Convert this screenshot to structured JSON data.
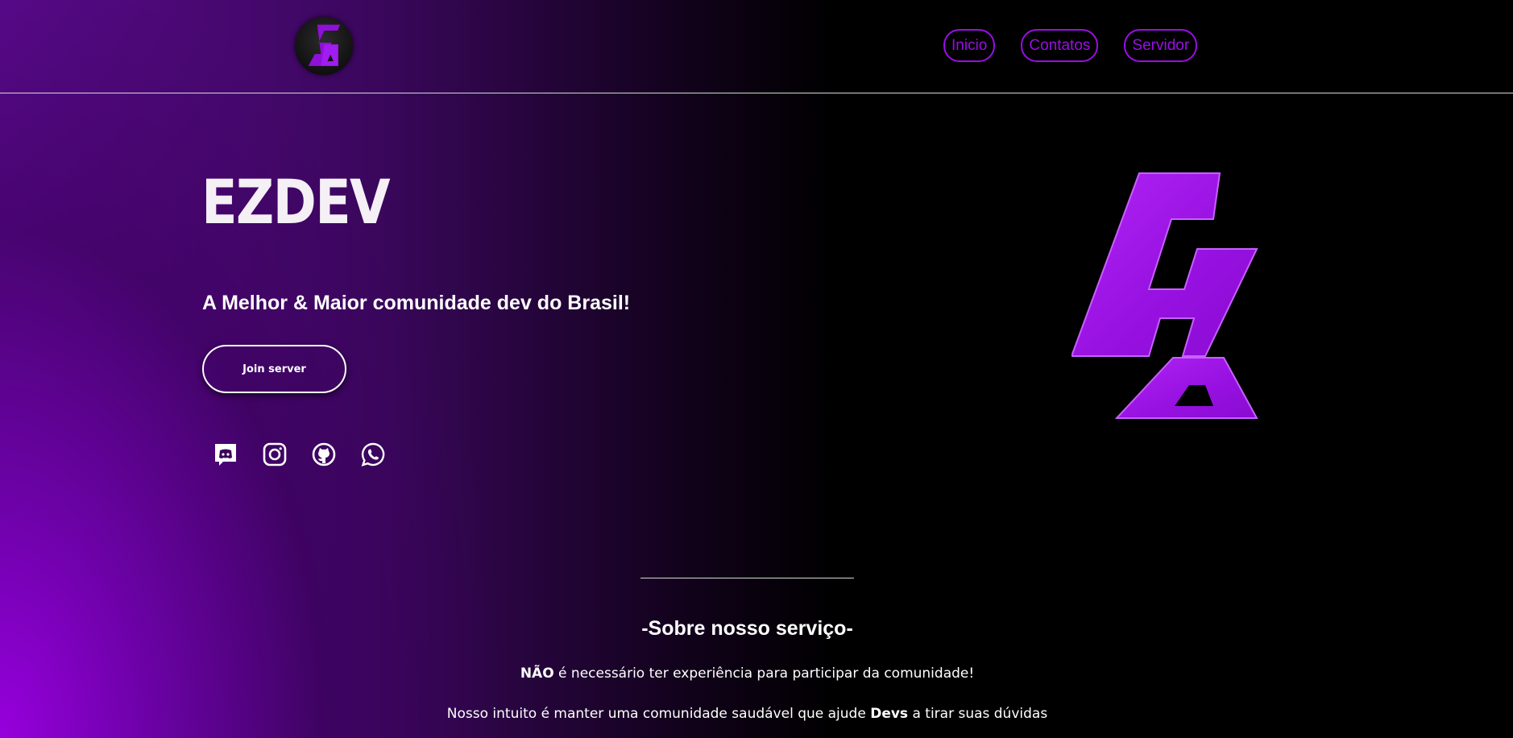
{
  "brand": {
    "accent": "#9a0ee6",
    "logo_letters": "EZ"
  },
  "nav": {
    "items": [
      {
        "label": "Inicio"
      },
      {
        "label": "Contatos"
      },
      {
        "label": "Servidor"
      }
    ]
  },
  "hero": {
    "title": "EZDEV",
    "subtitle": "A Melhor & Maior comunidade dev do Brasil!",
    "join_label": "Join server",
    "social_icons": [
      "discord-icon",
      "instagram-icon",
      "github-icon",
      "whatsapp-icon"
    ]
  },
  "about": {
    "title": "-Sobre nosso serviço-",
    "line1_strong": "NÃO",
    "line1_rest": " é necessário ter experiência para participar da comunidade!",
    "line2_pre": "Nosso intuito é manter uma comunidade saudável que ajude ",
    "line2_strong": "Devs",
    "line2_post": " a tirar suas dúvidas"
  }
}
